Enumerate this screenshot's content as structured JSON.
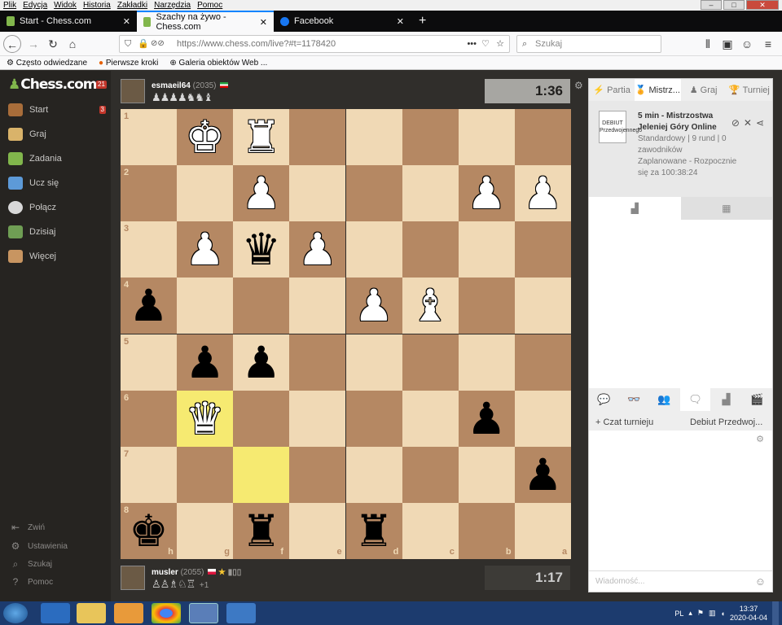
{
  "menubar": {
    "items": [
      "Plik",
      "Edycja",
      "Widok",
      "Historia",
      "Zakładki",
      "Narzędzia",
      "Pomoc"
    ]
  },
  "tabs": [
    {
      "label": "Start - Chess.com",
      "active": false
    },
    {
      "label": "Szachy na żywo - Chess.com",
      "active": true
    },
    {
      "label": "Facebook",
      "active": false
    }
  ],
  "navbar": {
    "url": "https://www.chess.com/live?#t=1178420",
    "url_domain": "chess.com",
    "search_placeholder": "Szukaj"
  },
  "bookmarks": [
    "Często odwiedzane",
    "Pierwsze kroki",
    "Galeria obiektów Web ..."
  ],
  "sidebar": {
    "logo": "Chess.com",
    "logo_badge": "21",
    "items": [
      {
        "label": "Start",
        "badge": "3",
        "icon": "home-icon"
      },
      {
        "label": "Graj",
        "icon": "play-pawn-icon"
      },
      {
        "label": "Zadania",
        "icon": "puzzle-icon"
      },
      {
        "label": "Ucz się",
        "icon": "learn-icon"
      },
      {
        "label": "Połącz",
        "icon": "chat-icon"
      },
      {
        "label": "Dzisiaj",
        "icon": "news-icon"
      },
      {
        "label": "Więcej",
        "icon": "more-icon"
      }
    ],
    "bottom": [
      {
        "label": "Zwiń",
        "icon": "collapse-icon"
      },
      {
        "label": "Ustawienia",
        "icon": "gear-icon"
      },
      {
        "label": "Szukaj",
        "icon": "search-icon"
      },
      {
        "label": "Pomoc",
        "icon": "help-icon"
      }
    ]
  },
  "top_player": {
    "name": "esmaeil64",
    "rating": "(2035)",
    "captured": "♟♟♟♟♞♞♝",
    "clock": "1:36"
  },
  "bottom_player": {
    "name": "musler",
    "rating": "(2055)",
    "captured": "♙♙♗♘♖",
    "plus": "+1",
    "clock": "1:17"
  },
  "board": {
    "ranks": [
      "1",
      "2",
      "3",
      "4",
      "5",
      "6",
      "7",
      "8"
    ],
    "files": [
      "h",
      "g",
      "f",
      "e",
      "d",
      "c",
      "b",
      "a"
    ],
    "highlight": [
      {
        "row": 5,
        "col": 1
      },
      {
        "row": 6,
        "col": 2
      }
    ],
    "pieces": [
      {
        "row": 0,
        "col": 1,
        "glyph": "♚",
        "color": "white"
      },
      {
        "row": 0,
        "col": 2,
        "glyph": "♜",
        "color": "white"
      },
      {
        "row": 1,
        "col": 2,
        "glyph": "♟",
        "color": "white"
      },
      {
        "row": 1,
        "col": 6,
        "glyph": "♟",
        "color": "white"
      },
      {
        "row": 1,
        "col": 7,
        "glyph": "♟",
        "color": "white"
      },
      {
        "row": 2,
        "col": 1,
        "glyph": "♟",
        "color": "white"
      },
      {
        "row": 2,
        "col": 2,
        "glyph": "♛",
        "color": "black"
      },
      {
        "row": 2,
        "col": 3,
        "glyph": "♟",
        "color": "white"
      },
      {
        "row": 3,
        "col": 0,
        "glyph": "♟",
        "color": "black"
      },
      {
        "row": 3,
        "col": 4,
        "glyph": "♟",
        "color": "white"
      },
      {
        "row": 3,
        "col": 5,
        "glyph": "♝",
        "color": "white"
      },
      {
        "row": 4,
        "col": 1,
        "glyph": "♟",
        "color": "black"
      },
      {
        "row": 4,
        "col": 2,
        "glyph": "♟",
        "color": "black"
      },
      {
        "row": 5,
        "col": 1,
        "glyph": "♛",
        "color": "white"
      },
      {
        "row": 5,
        "col": 6,
        "glyph": "♟",
        "color": "black"
      },
      {
        "row": 6,
        "col": 7,
        "glyph": "♟",
        "color": "black"
      },
      {
        "row": 7,
        "col": 0,
        "glyph": "♚",
        "color": "black"
      },
      {
        "row": 7,
        "col": 2,
        "glyph": "♜",
        "color": "black"
      },
      {
        "row": 7,
        "col": 4,
        "glyph": "♜",
        "color": "black"
      }
    ]
  },
  "right_panel": {
    "tabs": [
      "Partia",
      "Mistrz...",
      "Graj",
      "Turniej"
    ],
    "tournament": {
      "logo_text": "DEBIUT Przedwojennego",
      "title": "5 min - Mistrzostwa Jeleniej Góry Online",
      "meta": "Standardowy | 9 rund | 0 zawodników",
      "status": "Zaplanowane - Rozpocznie się za 100:38:24"
    },
    "chat_tab_label": "Czat turnieju",
    "debiut_tab_label": "Debiut Przedwoj...",
    "message_placeholder": "Wiadomość..."
  },
  "taskbar": {
    "lang": "PL",
    "time": "13:37",
    "date": "2020-04-04"
  }
}
